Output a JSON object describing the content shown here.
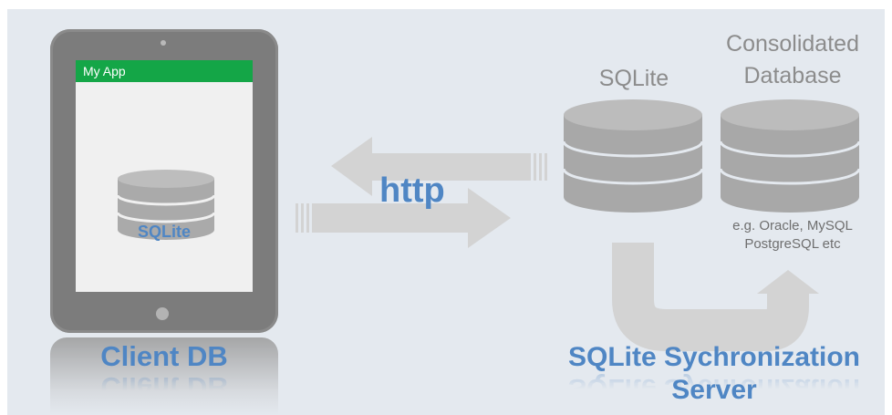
{
  "client": {
    "app_title": "My App",
    "db_label": "SQLite",
    "caption": "Client DB"
  },
  "transport": {
    "label": "http"
  },
  "server": {
    "sqlite_label": "SQLite",
    "consolidated_label_line1": "Consolidated",
    "consolidated_label_line2": "Database",
    "examples_line1": "e.g. Oracle, MySQL",
    "examples_line2": "PostgreSQL etc",
    "caption_line1": "SQLite Sychronization",
    "caption_line2": "Server"
  },
  "colors": {
    "accent_blue": "#4f86c4",
    "app_bar_green": "#14a647",
    "background": "#e4e9ef",
    "cylinder_gray": "#a8a8a8",
    "arrow_gray": "#d3d3d3"
  }
}
